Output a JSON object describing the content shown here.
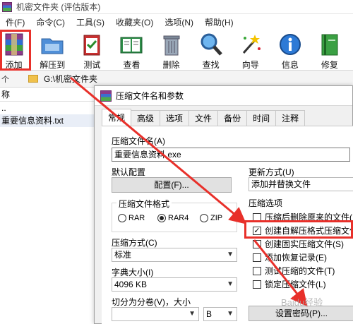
{
  "window": {
    "title": "机密文件夹 (评估版本)"
  },
  "menu": [
    "件(F)",
    "命令(C)",
    "工具(S)",
    "收藏夹(O)",
    "选项(N)",
    "帮助(H)"
  ],
  "toolbar": [
    {
      "label": "添加",
      "icon": "add-archive-icon"
    },
    {
      "label": "解压到",
      "icon": "extract-folder-icon"
    },
    {
      "label": "测试",
      "icon": "test-clipboard-icon"
    },
    {
      "label": "查看",
      "icon": "view-book-icon"
    },
    {
      "label": "删除",
      "icon": "trash-icon"
    },
    {
      "label": "查找",
      "icon": "magnifier-icon"
    },
    {
      "label": "向导",
      "icon": "wizard-wand-icon"
    },
    {
      "label": "信息",
      "icon": "info-icon"
    },
    {
      "label": "修复",
      "icon": "repair-book-icon"
    }
  ],
  "pathbar": {
    "up": "个",
    "path": "G:\\机密文件夹"
  },
  "filelist": {
    "header": "称",
    "rows": [
      "..",
      "重要信息资料.txt"
    ]
  },
  "dialog": {
    "title": "压缩文件名和参数",
    "tabs": [
      "常规",
      "高级",
      "选项",
      "文件",
      "备份",
      "时间",
      "注释"
    ],
    "archive_name_label": "压缩文件名(A)",
    "archive_name_value": "重要信息资料.exe",
    "default_config_label": "默认配置",
    "profile_button": "配置(F)...",
    "update_mode_label": "更新方式(U)",
    "update_mode_value": "添加并替换文件",
    "format_group_label": "压缩文件格式",
    "formats": [
      {
        "label": "RAR",
        "selected": false
      },
      {
        "label": "RAR4",
        "selected": true
      },
      {
        "label": "ZIP",
        "selected": false
      }
    ],
    "options_group_label": "压缩选项",
    "options": [
      {
        "label": "压缩后删除原来的文件(",
        "checked": false
      },
      {
        "label": "创建自解压格式压缩文件",
        "checked": true
      },
      {
        "label": "创建固实压缩文件(S)",
        "checked": false
      },
      {
        "label": "添加恢复记录(E)",
        "checked": false
      },
      {
        "label": "测试压缩的文件(T)",
        "checked": false
      },
      {
        "label": "锁定压缩文件(L)",
        "checked": false
      }
    ],
    "method_label": "压缩方式(C)",
    "method_value": "标准",
    "dict_label": "字典大小(I)",
    "dict_value": "4096 KB",
    "split_label": "切分为分卷(V)，大小",
    "split_value": "",
    "split_unit": "B",
    "password_button": "设置密码(P)..."
  },
  "watermark": "Baidu经验",
  "colors": {
    "highlight_red": "#e8302a",
    "dialog_bg": "#f0f0f0"
  }
}
